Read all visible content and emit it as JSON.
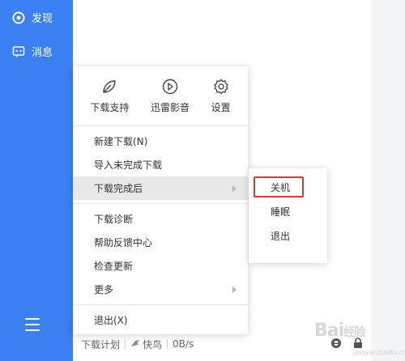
{
  "sidebar": {
    "items": [
      {
        "label": "发现",
        "icon": "discover-icon"
      },
      {
        "label": "消息",
        "icon": "message-icon"
      }
    ],
    "menu_icon": "hamburger-icon"
  },
  "menu": {
    "top_buttons": [
      {
        "label": "下载支持",
        "icon": "leaf-icon"
      },
      {
        "label": "迅雷影音",
        "icon": "play-circle-icon"
      },
      {
        "label": "设置",
        "icon": "gear-icon"
      }
    ],
    "sections": [
      [
        {
          "label": "新建下载(N)"
        },
        {
          "label": "导入未完成下载"
        },
        {
          "label": "下载完成后",
          "has_submenu": true,
          "active": true
        }
      ],
      [
        {
          "label": "下载诊断"
        },
        {
          "label": "帮助反馈中心"
        },
        {
          "label": "检查更新"
        },
        {
          "label": "更多",
          "has_submenu": true
        }
      ],
      [
        {
          "label": "退出(X)"
        }
      ]
    ]
  },
  "submenu": {
    "items": [
      {
        "label": "关机",
        "highlighted": true
      },
      {
        "label": "睡眠"
      },
      {
        "label": "退出"
      }
    ],
    "highlight_color": "#e0352c"
  },
  "status_bar": {
    "plan_label": "下载计划",
    "speed_label": "快鸟",
    "speed_value": "0B/s"
  },
  "watermark": {
    "text": "Bai",
    "suffix": "经验",
    "sub": "jingyan.baidu.com"
  },
  "colors": {
    "sidebar": "#3a80f2",
    "menu_active": "#e8e8e8"
  }
}
